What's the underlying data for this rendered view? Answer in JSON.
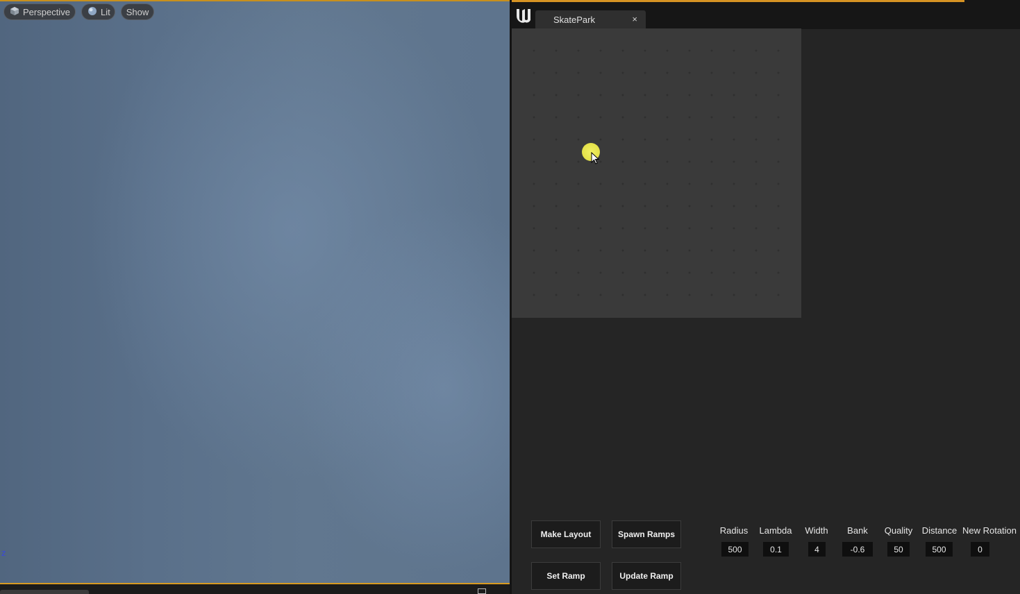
{
  "viewport": {
    "perspective_label": "Perspective",
    "lit_label": "Lit",
    "show_label": "Show",
    "axis_label": "z"
  },
  "editor": {
    "tab_title": "SkatePark",
    "tab_close": "×"
  },
  "buttons": {
    "make_layout": "Make Layout",
    "spawn_ramps": "Spawn Ramps",
    "set_ramp": "Set Ramp",
    "update_ramp": "Update Ramp"
  },
  "params": [
    {
      "label": "Radius",
      "value": "500"
    },
    {
      "label": "Lambda",
      "value": "0.1"
    },
    {
      "label": "Width",
      "value": "4"
    },
    {
      "label": "Bank",
      "value": "-0.6"
    },
    {
      "label": "Quality",
      "value": "50"
    },
    {
      "label": "Distance",
      "value": "500"
    },
    {
      "label": "New Rotation",
      "value": "0"
    }
  ],
  "colors": {
    "accent": "#d69323",
    "canvas": "#c3c3c3",
    "cursor_highlight": "#e6e34c"
  }
}
